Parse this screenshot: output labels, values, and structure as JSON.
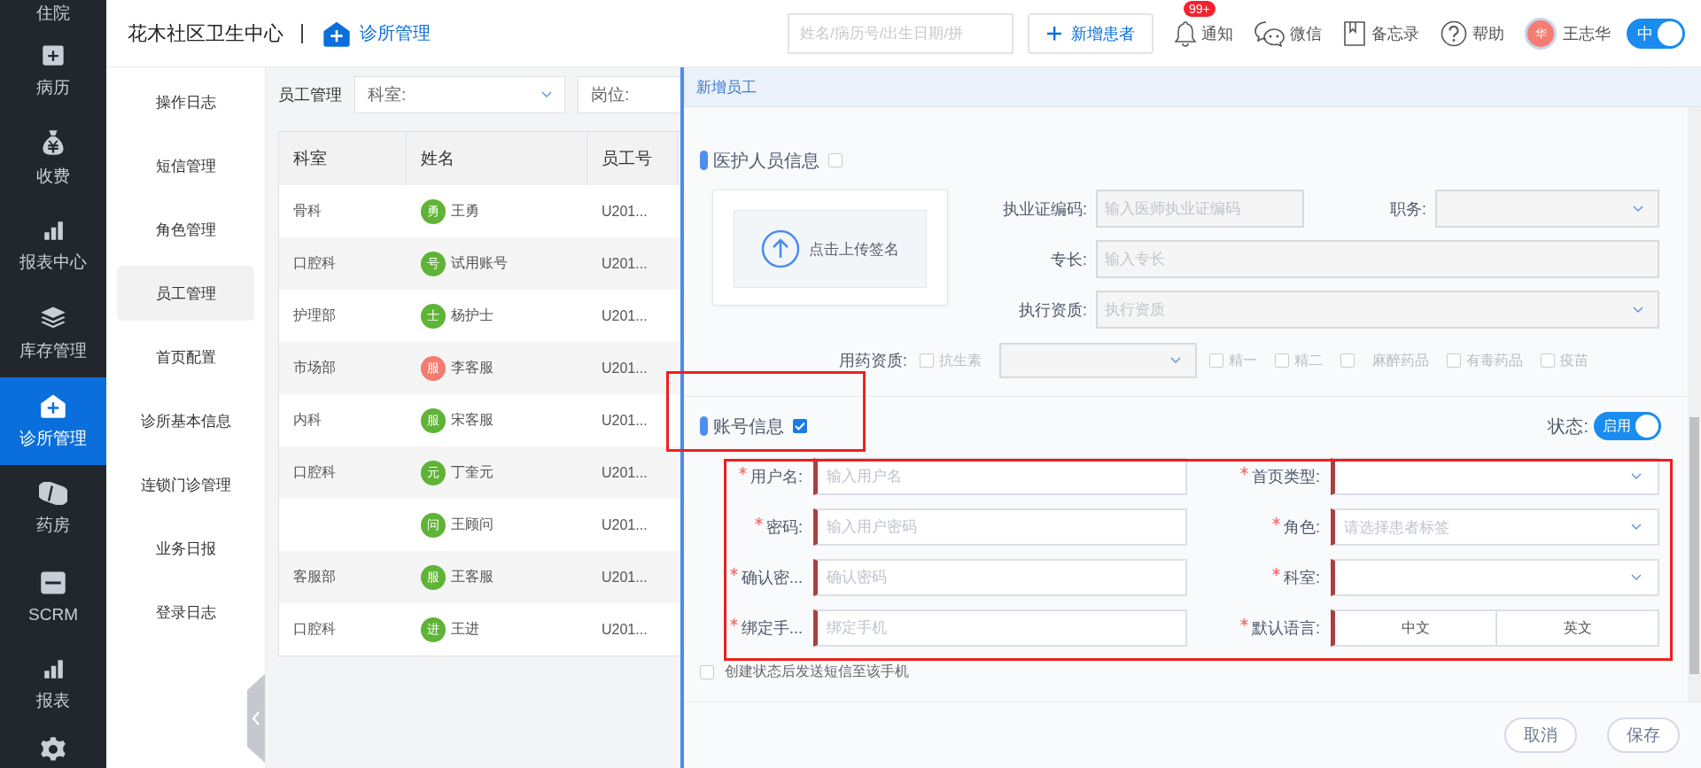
{
  "sidebar": {
    "items": [
      {
        "label": "住院",
        "selected": false
      },
      {
        "label": "病历",
        "selected": false
      },
      {
        "label": "收费",
        "selected": false
      },
      {
        "label": "报表中心",
        "selected": false
      },
      {
        "label": "库存管理",
        "selected": false
      },
      {
        "label": "诊所管理",
        "selected": true
      },
      {
        "label": "药房",
        "selected": false
      },
      {
        "label": "SCRM",
        "selected": false
      },
      {
        "label": "报表",
        "selected": false
      }
    ]
  },
  "header": {
    "clinic_name": "花木社区卫生中心",
    "module": "诊所管理",
    "search": {
      "placeholder": "姓名/病历号/出生日期/拼"
    },
    "new_patient_button": "新增患者",
    "tools": [
      {
        "label": "通知",
        "badge": "99+"
      },
      {
        "label": "微信"
      },
      {
        "label": "备忘录"
      },
      {
        "label": "帮助"
      }
    ],
    "user": {
      "avatar": "华",
      "name": "王志华"
    },
    "language_toggle": {
      "label": "中",
      "on": true
    }
  },
  "submenu": {
    "items": [
      {
        "label": "操作日志",
        "selected": false
      },
      {
        "label": "短信管理",
        "selected": false
      },
      {
        "label": "角色管理",
        "selected": false
      },
      {
        "label": "员工管理",
        "selected": true
      },
      {
        "label": "首页配置",
        "selected": false
      },
      {
        "label": "诊所基本信息",
        "selected": false
      },
      {
        "label": "连锁门诊管理",
        "selected": false
      },
      {
        "label": "业务日报",
        "selected": false
      },
      {
        "label": "登录日志",
        "selected": false
      }
    ]
  },
  "staff_list": {
    "title": "员工管理",
    "filters": [
      {
        "label": "科室:"
      },
      {
        "label": "岗位:"
      }
    ],
    "table": {
      "columns": [
        "科室",
        "姓名",
        "员工号"
      ],
      "rows": [
        {
          "department": "骨科",
          "avatar": "勇",
          "color": "#5fb336",
          "name": "王勇",
          "staff_id": "U201..."
        },
        {
          "department": "口腔科",
          "avatar": "号",
          "color": "#5fb336",
          "name": "试用账号",
          "staff_id": "U201..."
        },
        {
          "department": "护理部",
          "avatar": "士",
          "color": "#5fb336",
          "name": "杨护士",
          "staff_id": "U201..."
        },
        {
          "department": "市场部",
          "avatar": "服",
          "color": "#f47c70",
          "name": "李客服",
          "staff_id": "U201..."
        },
        {
          "department": "内科",
          "avatar": "服",
          "color": "#5fb336",
          "name": "宋客服",
          "staff_id": "U201..."
        },
        {
          "department": "口腔科",
          "avatar": "元",
          "color": "#5fb336",
          "name": "丁奎元",
          "staff_id": "U201..."
        },
        {
          "avatar": "问",
          "color": "#5fb336",
          "name": "王顾问",
          "staff_id": "U201..."
        },
        {
          "department": "客服部",
          "avatar": "服",
          "color": "#5fb336",
          "name": "王客服",
          "staff_id": "U201..."
        },
        {
          "department": "口腔科",
          "avatar": "进",
          "color": "#5fb336",
          "name": "王进",
          "staff_id": "U201..."
        }
      ]
    }
  },
  "drawer": {
    "title": "新增员工",
    "medical_section": {
      "title": "医护人员信息",
      "checked": false,
      "upload": "点击上传签名",
      "license": {
        "label": "执业证编码:",
        "placeholder": "输入医师执业证编码"
      },
      "position": {
        "label": "职务:"
      },
      "specialty": {
        "label": "专长:",
        "placeholder": "输入专长"
      },
      "qualification": {
        "label": "执行资质:",
        "placeholder": "执行资质"
      },
      "drug_permissions": {
        "label": "用药资质:",
        "options": [
          {
            "kind": "checkbox",
            "label": "抗生素",
            "checked": false
          },
          {
            "kind": "select"
          },
          {
            "kind": "checkbox",
            "label": "精一",
            "checked": false
          },
          {
            "kind": "checkbox",
            "label": "精二",
            "checked": false
          },
          {
            "kind": "checkbox",
            "label": "麻醉药品",
            "checked": false
          },
          {
            "kind": "checkbox",
            "label": "有毒药品",
            "checked": false
          },
          {
            "kind": "checkbox",
            "label": "疫苗",
            "checked": false
          }
        ]
      }
    },
    "account_section": {
      "title": "账号信息",
      "checked": true,
      "status": {
        "label": "状态:",
        "toggle": "启用",
        "on": true
      },
      "fields": [
        {
          "kind": "input",
          "label": "用户名:",
          "required": true,
          "placeholder": "输入用户名"
        },
        {
          "kind": "select",
          "label": "首页类型:",
          "required": true
        },
        {
          "kind": "input",
          "label": "密码:",
          "required": true,
          "placeholder": "输入用户密码"
        },
        {
          "kind": "select",
          "label": "角色:",
          "required": true,
          "placeholder": "请选择患者标签"
        },
        {
          "kind": "input",
          "label": "确认密...",
          "required": true,
          "placeholder": "确认密码"
        },
        {
          "kind": "select",
          "label": "科室:",
          "required": true
        },
        {
          "kind": "input",
          "label": "绑定手...",
          "required": true,
          "placeholder": "绑定手机"
        },
        {
          "kind": "segmented",
          "label": "默认语言:",
          "required": true,
          "options": [
            "中文",
            "英文"
          ]
        }
      ],
      "sms_notice": {
        "label": "创建状态后发送短信至该手机",
        "checked": false
      }
    },
    "buttons": [
      "取消",
      "保存"
    ]
  }
}
